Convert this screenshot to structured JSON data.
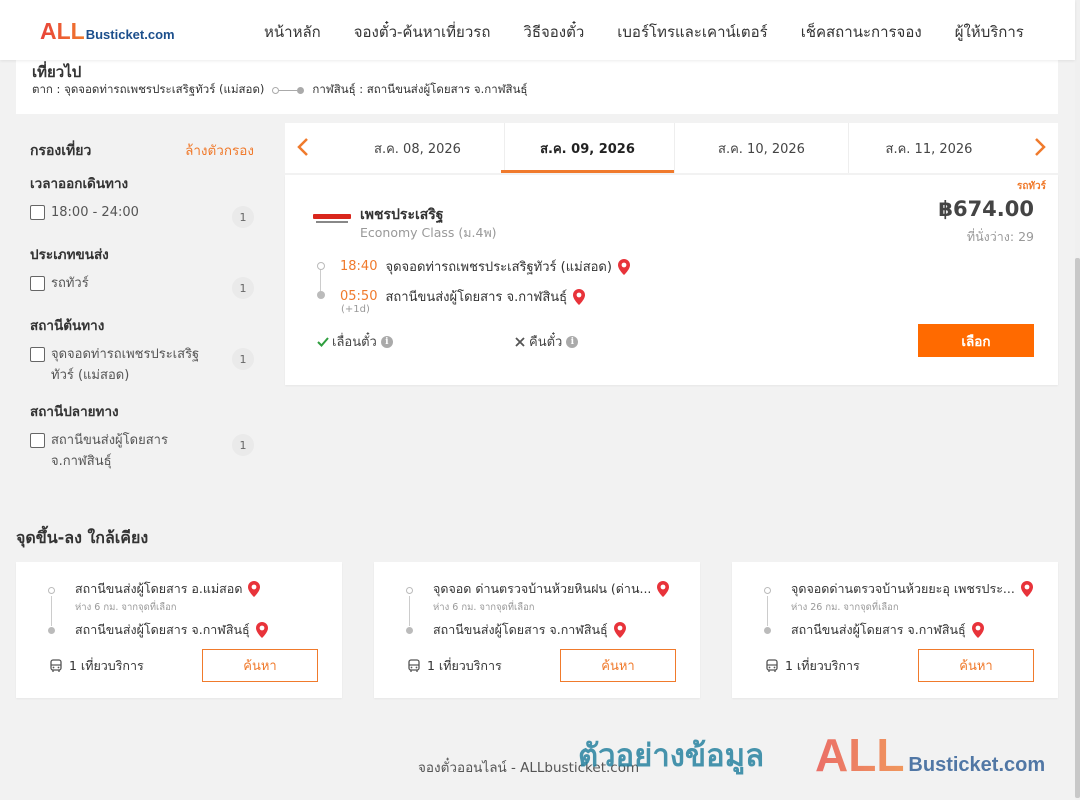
{
  "header": {
    "logo_all": "ALL",
    "logo_rest": "Busticket.com",
    "nav": [
      "หน้าหลัก",
      "จองตั๋ว-ค้นหาเที่ยวรถ",
      "วิธีจองตั๋ว",
      "เบอร์โทรและเคาน์เตอร์",
      "เช็คสถานะการจอง",
      "ผู้ให้บริการ"
    ]
  },
  "trip": {
    "title": "เที่ยวไป",
    "from": "ตาก : จุดจอดท่ารถเพชรประเสริฐทัวร์ (แม่สอด)",
    "to": "กาฬสินธุ์ : สถานีขนส่งผู้โดยสาร จ.กาฬสินธุ์"
  },
  "filters": {
    "heading": "กรองเที่ยว",
    "clear": "ล้างตัวกรอง",
    "sections": [
      {
        "title": "เวลาออกเดินทาง",
        "option": "18:00 - 24:00",
        "count": "1"
      },
      {
        "title": "ประเภทขนส่ง",
        "option": "รถทัวร์",
        "count": "1"
      },
      {
        "title": "สถานีต้นทาง",
        "option": "จุดจอดท่ารถเพชรประเสริฐทัวร์ (แม่สอด)",
        "count": "1"
      },
      {
        "title": "สถานีปลายทาง",
        "option": "สถานีขนส่งผู้โดยสาร จ.กาฬสินธุ์",
        "count": "1"
      }
    ]
  },
  "dates": [
    "ส.ค. 08, 2026",
    "ส.ค. 09, 2026",
    "ส.ค. 10, 2026",
    "ส.ค. 11, 2026"
  ],
  "result": {
    "tag": "รถทัวร์",
    "operator": "เพชรประเสริฐ",
    "class": "Economy Class (ม.4พ)",
    "price": "฿674.00",
    "seats": "ที่นั่งว่าง: 29",
    "depart_time": "18:40",
    "depart_place": "จุดจอดท่ารถเพชรประเสริฐทัวร์ (แม่สอด)",
    "arrive_time": "05:50",
    "arrive_place": "สถานีขนส่งผู้โดยสาร จ.กาฬสินธุ์",
    "plus_day": "(+1d)",
    "reschedule": "เลื่อนตั๋ว",
    "refund": "คืนตั๋ว",
    "select_label": "เลือก"
  },
  "nearby": {
    "title": "จุดขึ้น-ลง ใกล้เคียง",
    "cards": [
      {
        "from": "สถานีขนส่งผู้โดยสาร อ.แม่สอด",
        "distance": "ห่าง 6 กม. จากจุดที่เลือก",
        "to": "สถานีขนส่งผู้โดยสาร จ.กาฬสินธุ์",
        "trips": "1 เที่ยวบริการ",
        "button": "ค้นหา"
      },
      {
        "from": "จุดจอด ด่านตรวจบ้านห้วยหินฝน (ด่าน...",
        "distance": "ห่าง 6 กม. จากจุดที่เลือก",
        "to": "สถานีขนส่งผู้โดยสาร จ.กาฬสินธุ์",
        "trips": "1 เที่ยวบริการ",
        "button": "ค้นหา"
      },
      {
        "from": "จุดจอดด่านตรวจบ้านห้วยยะอุ เพชรประ...",
        "distance": "ห่าง 26 กม. จากจุดที่เลือก",
        "to": "สถานีขนส่งผู้โดยสาร จ.กาฬสินธุ์",
        "trips": "1 เที่ยวบริการ",
        "button": "ค้นหา"
      }
    ]
  },
  "footer": {
    "text": "จองตั๋วออนไลน์ - ALLbusticket.com",
    "watermark_text": "ตัวอย่างข้อมูล",
    "watermark_logo_all": "ALL",
    "watermark_logo_rest": "Busticket.com"
  },
  "colors": {
    "accent": "#f07a2c",
    "button": "#ff6a00",
    "pin": "#e8333a",
    "check": "#2e9e3e"
  }
}
